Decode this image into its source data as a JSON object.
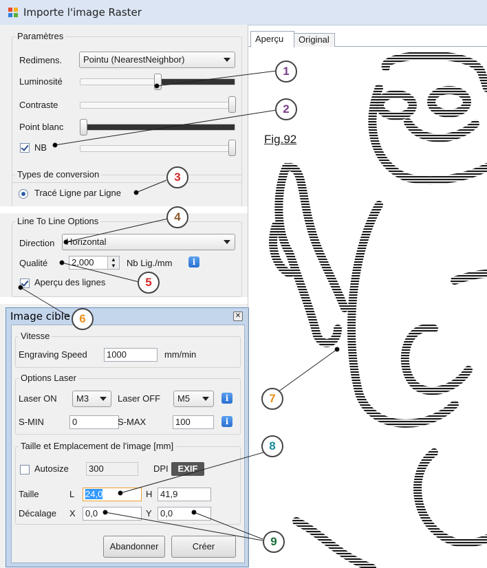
{
  "window": {
    "title": "Importe l'image Raster"
  },
  "parametres": {
    "group_title": "Paramètres",
    "redimens_label": "Redimens.",
    "redimens_value": "Pointu (NearestNeighbor)",
    "luminosite_label": "Luminosité",
    "contraste_label": "Contraste",
    "point_blanc_label": "Point blanc",
    "nb_label": "NB",
    "nb_checked": true
  },
  "conversion": {
    "group_title": "Types de conversion",
    "option_label": "Tracé Ligne par Ligne",
    "selected": true
  },
  "line_options": {
    "group_title": "Line To Line Options",
    "direction_label": "Direction",
    "direction_value": "Horizontal",
    "qualite_label": "Qualité",
    "qualite_value": "2,000",
    "unit_label": "Nb Lig./mm",
    "apercu_label": "Aperçu des lignes",
    "apercu_checked": true
  },
  "dialog": {
    "title": "Image cible",
    "vitesse": {
      "group_title": "Vitesse",
      "speed_label": "Engraving Speed",
      "speed_value": "1000",
      "speed_unit": "mm/min"
    },
    "laser": {
      "group_title": "Options Laser",
      "laser_on_label": "Laser ON",
      "laser_on_value": "M3",
      "laser_off_label": "Laser OFF",
      "laser_off_value": "M5",
      "smin_label": "S-MIN",
      "smin_value": "0",
      "smax_label": "S-MAX",
      "smax_value": "100"
    },
    "taille": {
      "group_title": "Taille et Emplacement de l'image [mm]",
      "autosize_label": "Autosize",
      "autosize_checked": false,
      "dpi_value": "300",
      "dpi_label": "DPI",
      "exif_label": "EXIF",
      "taille_label": "Taille",
      "l_label": "L",
      "l_value": "24,0",
      "h_label": "H",
      "h_value": "41,9",
      "decalage_label": "Décalage",
      "x_label": "X",
      "x_value": "0,0",
      "y_label": "Y",
      "y_value": "0,0"
    },
    "cancel_label": "Abandonner",
    "create_label": "Créer"
  },
  "tabs": [
    {
      "label": "Aperçu",
      "active": true
    },
    {
      "label": "Original",
      "active": false
    }
  ],
  "figure_label": "Fig.92",
  "callouts": [
    {
      "num": "1",
      "color": "#7a3f8c"
    },
    {
      "num": "2",
      "color": "#7a3f8c"
    },
    {
      "num": "3",
      "color": "#d42a2a"
    },
    {
      "num": "4",
      "color": "#8b5a2b"
    },
    {
      "num": "5",
      "color": "#d42a2a"
    },
    {
      "num": "6",
      "color": "#e8901a"
    },
    {
      "num": "7",
      "color": "#e8901a"
    },
    {
      "num": "8",
      "color": "#1a8c9c"
    },
    {
      "num": "9",
      "color": "#1a6b3c"
    }
  ],
  "icons": {
    "info": "info-icon",
    "app": "app-icon",
    "close": "close-icon"
  }
}
